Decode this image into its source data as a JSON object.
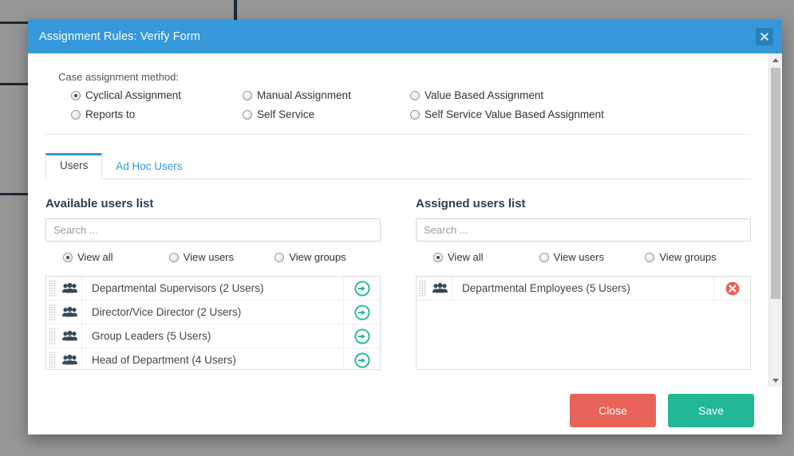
{
  "background": {
    "description": "grey page behind modal with dark table rules"
  },
  "modal": {
    "title": "Assignment Rules: Verify Form",
    "close_icon": "close-x-icon",
    "assignment": {
      "label": "Case assignment method:",
      "options": [
        {
          "label": "Cyclical Assignment",
          "checked": true
        },
        {
          "label": "Manual Assignment",
          "checked": false
        },
        {
          "label": "Value Based Assignment",
          "checked": false
        },
        {
          "label": "Reports to",
          "checked": false
        },
        {
          "label": "Self Service",
          "checked": false
        },
        {
          "label": "Self Service Value Based Assignment",
          "checked": false
        }
      ]
    },
    "tabs": [
      {
        "label": "Users",
        "active": true
      },
      {
        "label": "Ad Hoc Users",
        "active": false
      }
    ],
    "available": {
      "title": "Available users list",
      "search_placeholder": "Search ...",
      "search_value": "",
      "filters": [
        {
          "label": "View all",
          "checked": true
        },
        {
          "label": "View users",
          "checked": false
        },
        {
          "label": "View groups",
          "checked": false
        }
      ],
      "items": [
        {
          "label": "Departmental Supervisors (2 Users)",
          "icon": "group-icon",
          "action_icon": "arrow-right-circle-icon"
        },
        {
          "label": "Director/Vice Director (2 Users)",
          "icon": "group-icon",
          "action_icon": "arrow-right-circle-icon"
        },
        {
          "label": "Group Leaders (5 Users)",
          "icon": "group-icon",
          "action_icon": "arrow-right-circle-icon"
        },
        {
          "label": "Head of Department (4 Users)",
          "icon": "group-icon",
          "action_icon": "arrow-right-circle-icon"
        }
      ]
    },
    "assigned": {
      "title": "Assigned users list",
      "search_placeholder": "Search ...",
      "search_value": "",
      "filters": [
        {
          "label": "View all",
          "checked": true
        },
        {
          "label": "View users",
          "checked": false
        },
        {
          "label": "View groups",
          "checked": false
        }
      ],
      "items": [
        {
          "label": "Departmental Employees (5 Users)",
          "icon": "group-icon",
          "action_icon": "remove-x-circle-icon"
        }
      ]
    },
    "footer": {
      "close_label": "Close",
      "save_label": "Save"
    },
    "scrollbar": {
      "up_icon": "caret-up-icon",
      "down_icon": "caret-down-icon"
    }
  },
  "colors": {
    "header_blue": "#3498db",
    "close_red": "#e8635a",
    "save_green": "#21b795",
    "action_green": "#21b795",
    "remove_red": "#e8635a",
    "overlay_grey": "#969696"
  }
}
